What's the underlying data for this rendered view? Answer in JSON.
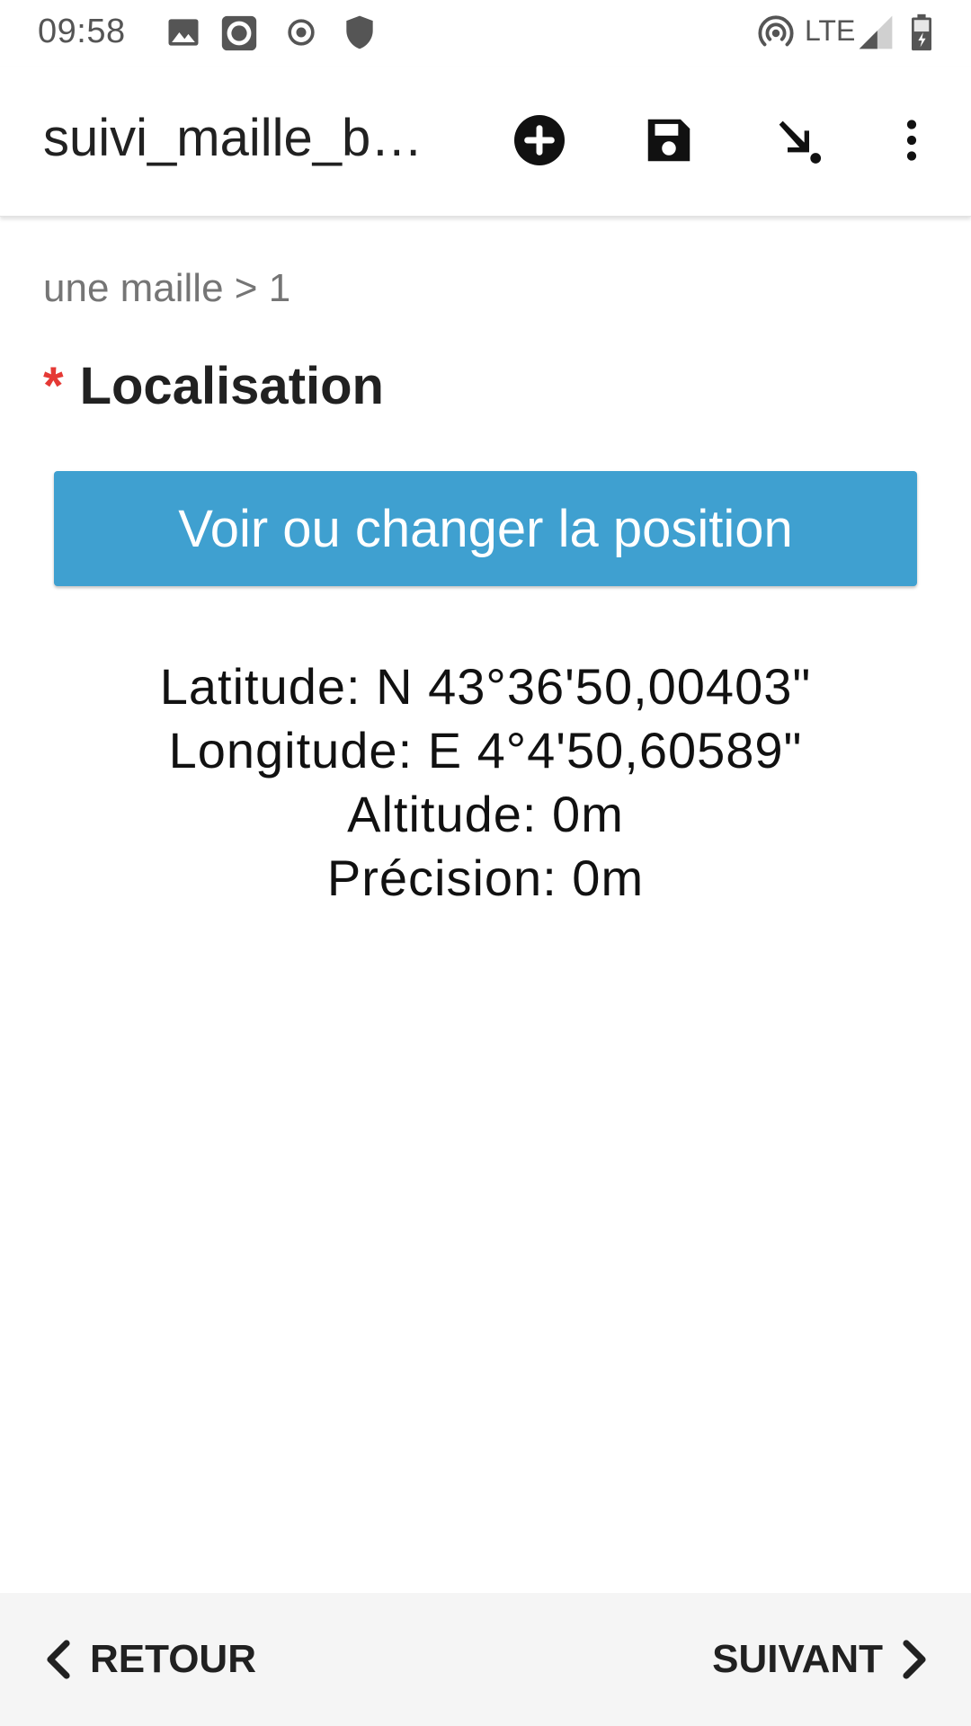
{
  "status_bar": {
    "time": "09:58",
    "network": "LTE",
    "icons": [
      "image-icon",
      "record-icon",
      "radio-icon",
      "shield-icon",
      "hotspot-icon",
      "signal-icon",
      "battery-icon"
    ]
  },
  "app_bar": {
    "title": "suivi_maille_b…",
    "actions": [
      "add-circle-icon",
      "save-icon",
      "arrow-down-right-icon",
      "more-vert-icon"
    ]
  },
  "breadcrumb": "une maille > 1",
  "field": {
    "required_marker": "*",
    "label": "Localisation"
  },
  "position_button": {
    "label": "Voir ou changer la position"
  },
  "coordinates": {
    "latitude": "Latitude: N 43°36'50,00403\"",
    "longitude": "Longitude: E 4°4'50,60589\"",
    "altitude": "Altitude: 0m",
    "precision": "Précision: 0m"
  },
  "navigation": {
    "back_label": "RETOUR",
    "next_label": "SUIVANT"
  },
  "colors": {
    "accent": "#3fa0d0",
    "required": "#e53935",
    "bottom_bar": "#f5f5f5"
  }
}
